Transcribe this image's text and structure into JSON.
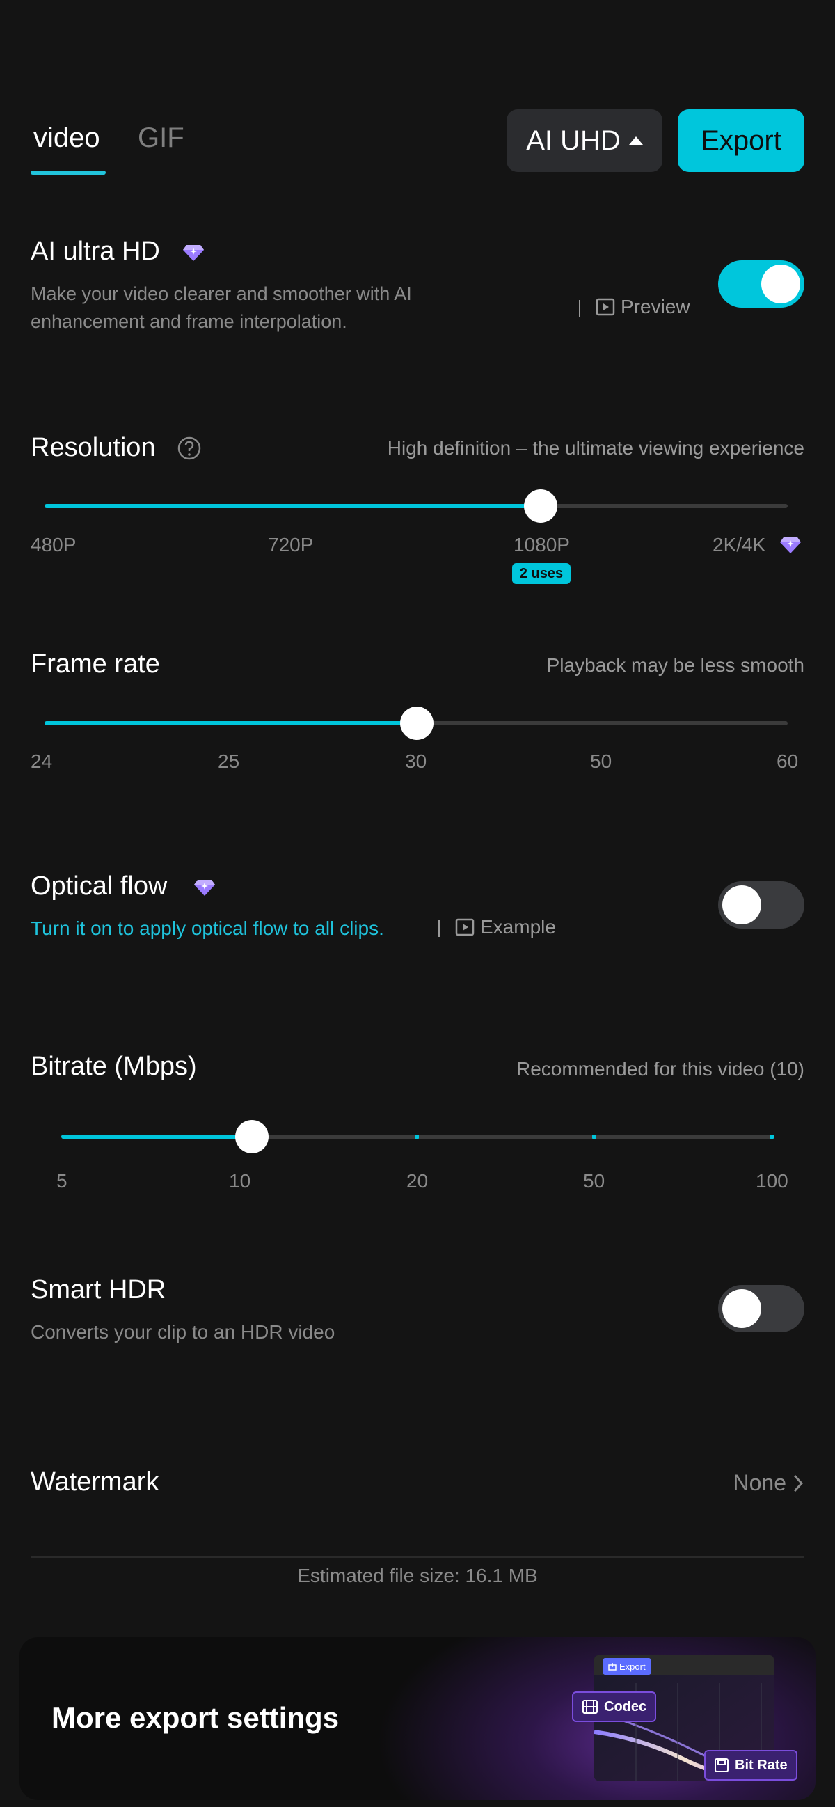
{
  "header": {
    "tabs": [
      {
        "label": "video",
        "active": true
      },
      {
        "label": "GIF",
        "active": false
      }
    ],
    "quality_button": "AI UHD",
    "export_button": "Export"
  },
  "ai_ultra_hd": {
    "title": "AI ultra HD",
    "description_line1": "Make your video clearer and smoother with AI",
    "description_line2": "enhancement and frame interpolation.",
    "preview_link": "Preview",
    "enabled": true
  },
  "resolution": {
    "title": "Resolution",
    "hint": "High definition – the ultimate viewing experience",
    "options": [
      "480P",
      "720P",
      "1080P",
      "2K/4K"
    ],
    "selected": "1080P",
    "uses_badge": "2 uses"
  },
  "frame_rate": {
    "title": "Frame rate",
    "hint": "Playback may be less smooth",
    "options": [
      "24",
      "25",
      "30",
      "50",
      "60"
    ],
    "selected": "30"
  },
  "optical_flow": {
    "title": "Optical flow",
    "description": "Turn it on to apply optical flow to all clips.",
    "example_link": "Example",
    "enabled": false
  },
  "bitrate": {
    "title": "Bitrate (Mbps)",
    "hint": "Recommended for this video (10)",
    "options": [
      "5",
      "10",
      "20",
      "50",
      "100"
    ],
    "selected": "10"
  },
  "smart_hdr": {
    "title": "Smart HDR",
    "description": "Converts your clip to an HDR video",
    "enabled": false
  },
  "watermark": {
    "title": "Watermark",
    "value": "None"
  },
  "estimated_size": "Estimated file size: 16.1 MB",
  "banner": {
    "title": "More export settings",
    "export_chip": "Export",
    "codec_chip": "Codec",
    "bitrate_chip": "Bit Rate"
  },
  "colors": {
    "accent": "#00c6dc",
    "background": "#141414",
    "premium": "#9b7bff"
  }
}
